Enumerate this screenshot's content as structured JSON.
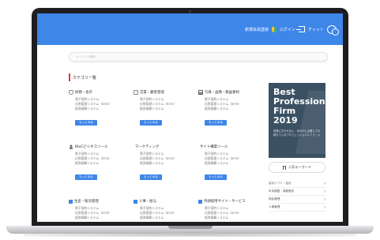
{
  "header": {
    "free_register": "新規会員登録",
    "login": "ログイン",
    "chat": "チャット"
  },
  "search": {
    "placeholder": "キーワード検索"
  },
  "section_title": "カテゴリ一覧",
  "more_label": "もっとみる",
  "categories": [
    {
      "title": "財務・会計",
      "icon": "hand-icon",
      "items": [
        "電子契約システム",
        "出張管理システム（BTM）",
        "経費精算システム"
      ]
    },
    {
      "title": "営業・顧客管理",
      "icon": "cart-icon",
      "items": [
        "電子契約システム",
        "出張管理システム（BTM）",
        "経費精算システム"
      ]
    },
    {
      "title": "写真・画像・動画素材",
      "icon": "media-icon",
      "items": [
        "電子契約システム",
        "出張管理システム（BTM）",
        "経費精算システム"
      ]
    },
    {
      "title": "BtoCビジネスツール",
      "icon": "person-icon",
      "items": [
        "電子契約システム",
        "出張管理システム（BTM）",
        "経費精算システム"
      ]
    },
    {
      "title": "マーケティング",
      "icon": "",
      "items": [
        "電子契約システム",
        "出張管理システム（BTM）",
        "経費精算システム"
      ]
    },
    {
      "title": "サイト構築ツール",
      "icon": "",
      "items": [
        "電子契約システム",
        "出張管理システム（BTM）",
        "経費精算システム"
      ]
    },
    {
      "title": "生産・販売管理",
      "icon": "square-icon",
      "items": [
        "電子契約システム",
        "出張管理システム（BTM）",
        "経費精算システム"
      ]
    },
    {
      "title": "人事・給与",
      "icon": "square-icon",
      "items": [
        "電子契約システム",
        "出張管理システム（BTM）",
        "経費精算システム"
      ]
    },
    {
      "title": "申請採用サイト・サービス",
      "icon": "square-icon",
      "items": [
        "電子契約システム",
        "出張管理システム（BTM）",
        "経費精算システム"
      ]
    }
  ],
  "banner": {
    "line1": "Best",
    "line2": "Professional",
    "line3": "Firm",
    "line4": "2019",
    "sub": "成長に欠かせない、世の中に必要とされ続けているプロフェッショナルファーム"
  },
  "keywords": {
    "button": "人気キーワード",
    "items": [
      "会計ソフト・会計",
      "年末調整・源泉徴収",
      "勤怠管理",
      "人事管理"
    ]
  },
  "colors": {
    "primary": "#3e86e8",
    "accent": "#e53935",
    "banner": "#3b5163"
  }
}
